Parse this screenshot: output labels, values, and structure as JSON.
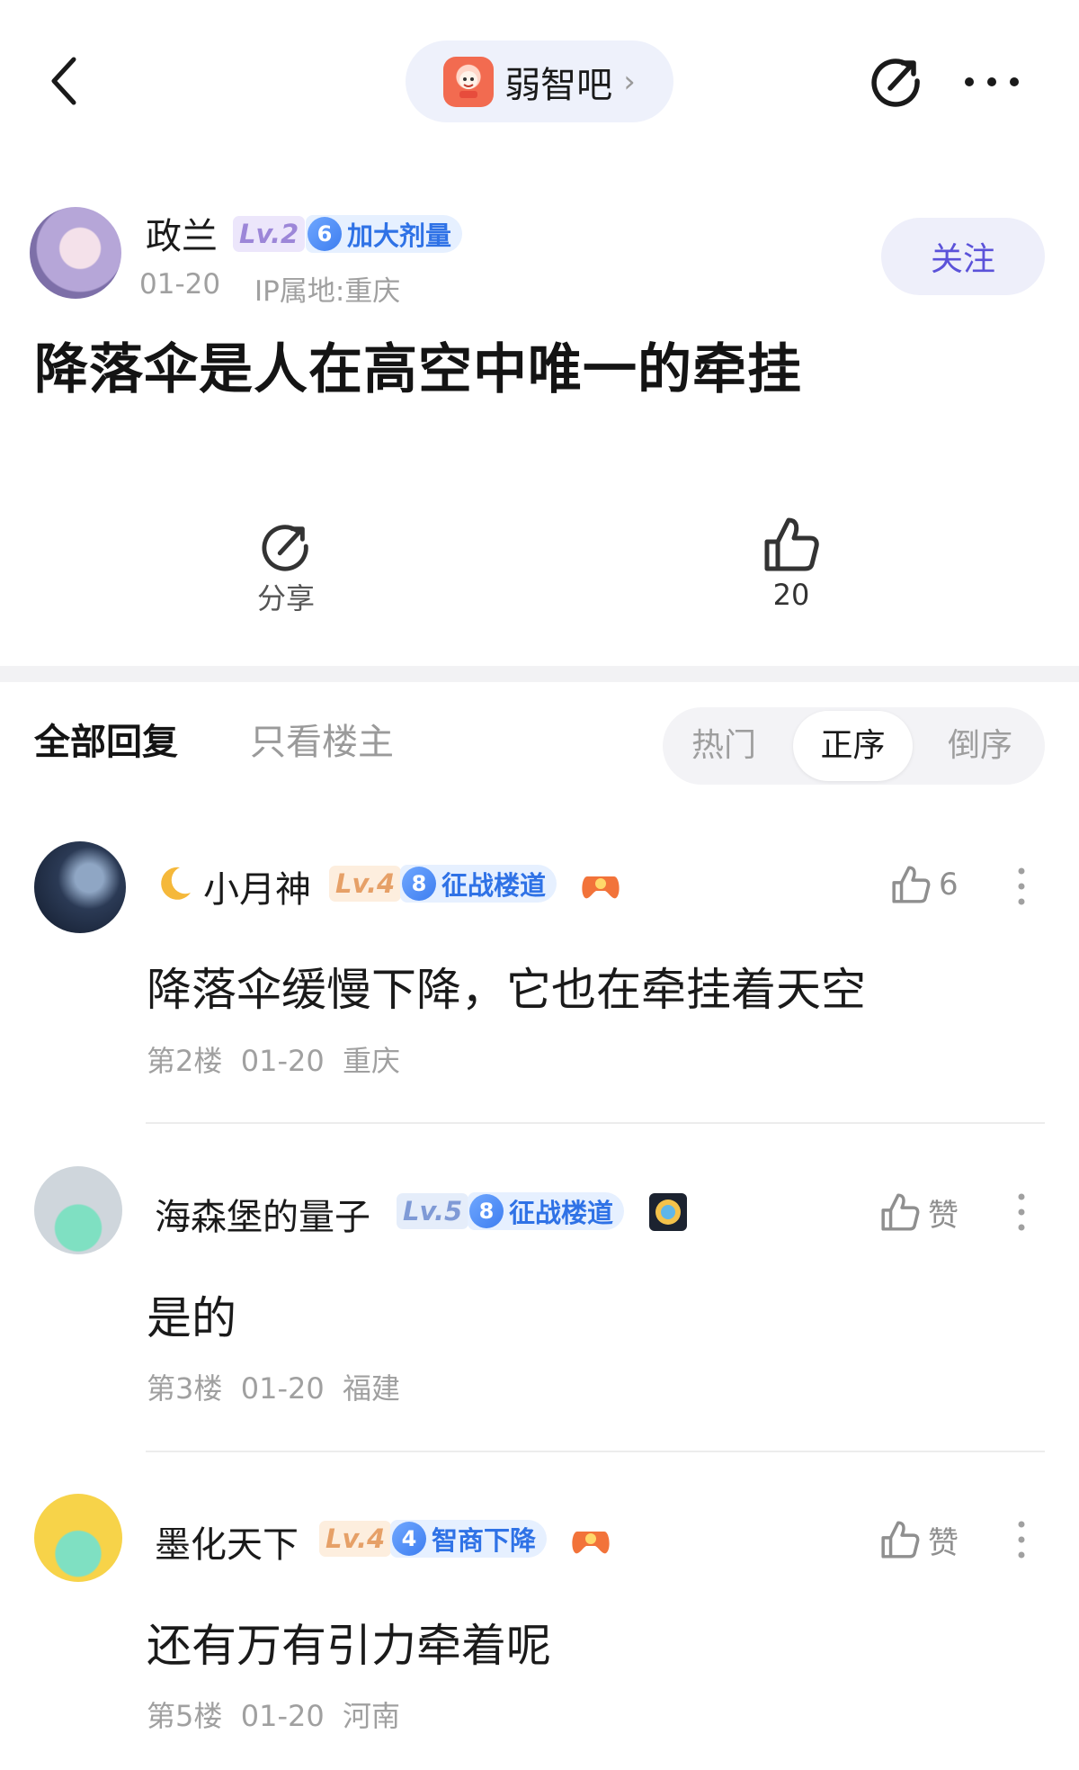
{
  "header": {
    "forum_name": "弱智吧",
    "back_icon": "chevron-left-icon",
    "share_icon": "share-icon",
    "more_icon": "more-icon"
  },
  "post": {
    "author": "政兰",
    "level": "Lv.2",
    "badge_level": "6",
    "badge_text": "加大剂量",
    "date": "01-20",
    "ip": "IP属地:重庆",
    "follow_label": "关注",
    "title": "降落伞是人在高空中唯一的牵挂",
    "share_label": "分享",
    "like_count": "20"
  },
  "replies_bar": {
    "tab_all": "全部回复",
    "tab_op_only": "只看楼主",
    "sort_options": [
      "热门",
      "正序",
      "倒序"
    ],
    "sort_selected": "正序"
  },
  "replies": [
    {
      "name": "小月神",
      "level": "Lv.4",
      "badge_level": "8",
      "badge_text": "征战楼道",
      "likes": "6",
      "text": "降落伞缓慢下降，它也在牵挂着天空",
      "floor": "第2楼",
      "date": "01-20",
      "location": "重庆"
    },
    {
      "name": "海森堡的量子",
      "level": "Lv.5",
      "badge_level": "8",
      "badge_text": "征战楼道",
      "likes": "赞",
      "text": "是的",
      "floor": "第3楼",
      "date": "01-20",
      "location": "福建"
    },
    {
      "name": "墨化天下",
      "level": "Lv.4",
      "badge_level": "4",
      "badge_text": "智商下降",
      "likes": "赞",
      "text": "还有万有引力牵着呢",
      "floor": "第5楼",
      "date": "01-20",
      "location": "河南"
    }
  ]
}
